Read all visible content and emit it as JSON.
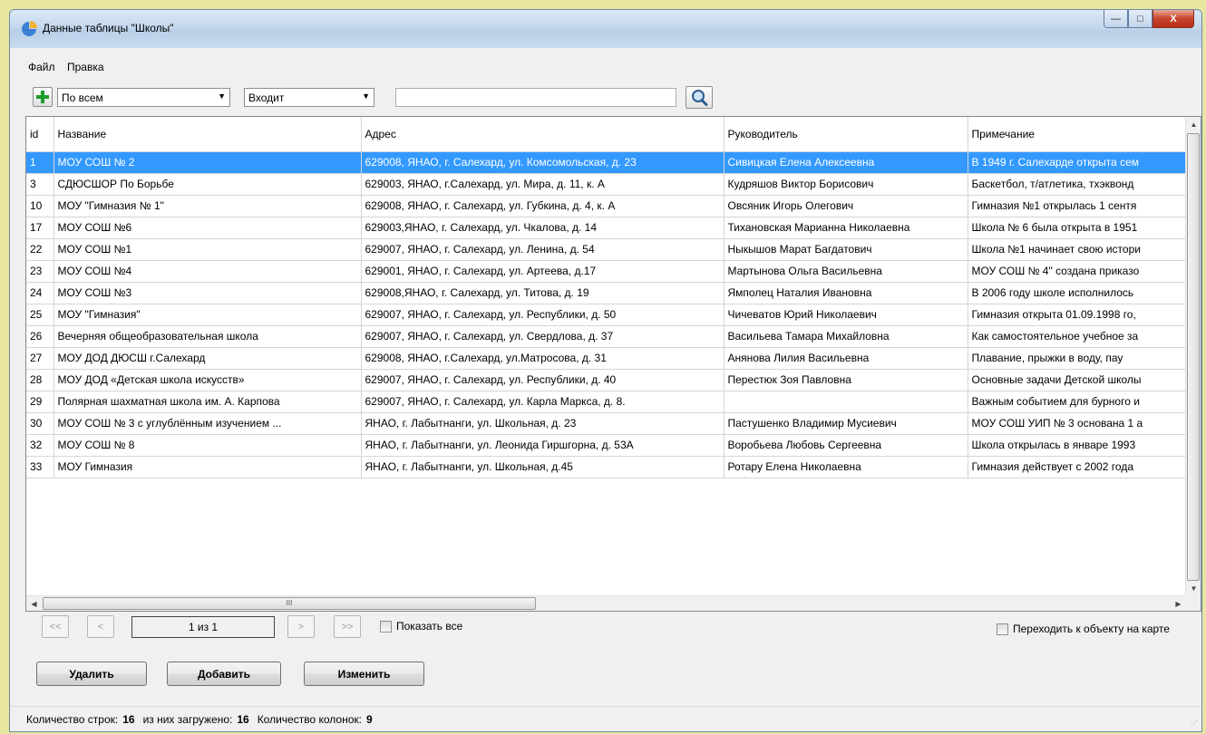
{
  "window": {
    "title": "Данные таблицы \"Школы\"",
    "controls": {
      "minimize": "—",
      "maximize": "□",
      "close": "X"
    }
  },
  "menu": [
    "Файл",
    "Правка"
  ],
  "toolbar": {
    "field_combo": "По всем",
    "condition_combo": "Входит",
    "search_value": ""
  },
  "grid": {
    "columns": [
      "id",
      "Название",
      "Адрес",
      "Руководитель",
      "Примечание"
    ],
    "rows": [
      [
        "1",
        "МОУ СОШ № 2",
        "629008, ЯНАО, г. Салехард, ул. Комсомольская, д. 23",
        "Сивицкая Елена Алексеевна",
        "В 1949 г. Салехарде открыта сем"
      ],
      [
        "3",
        "СДЮСШОР По Борьбе",
        "629003, ЯНАО,  г.Салехард, ул. Мира,  д. 11, к. А",
        "Кудряшов Виктор Борисович",
        "Баскетбол, т/атлетика, тхэквонд"
      ],
      [
        "10",
        "МОУ \"Гимназия № 1\"",
        "629008, ЯНАО, г. Салехард, ул. Губкина, д. 4, к. А",
        "Овсяник Игорь Олегович",
        "Гимназия №1 открылась 1 сентя"
      ],
      [
        "17",
        "МОУ СОШ №6",
        "629003,ЯНАО, г. Салехард, ул. Чкалова, д. 14",
        "Тихановская Марианна Николаевна",
        "Школа № 6 была открыта в 1951"
      ],
      [
        "22",
        "МОУ СОШ №1",
        "629007, ЯНАО, г. Салехард, ул. Ленина, д. 54",
        "Ныкышов Марат Багдатович",
        "Школа №1 начинает свою истори"
      ],
      [
        "23",
        "МОУ СОШ №4",
        "629001, ЯНАО, г. Салехард, ул. Артеева, д.17",
        "Мартынова Ольга Васильевна",
        "МОУ СОШ № 4\" создана приказо"
      ],
      [
        "24",
        "МОУ СОШ №3",
        "629008,ЯНАО, г. Салехард, ул. Титова, д. 19",
        "Ямполец Наталия Ивановна",
        "В 2006 году школе исполнилось"
      ],
      [
        "25",
        "МОУ \"Гимназия\"",
        "629007, ЯНАО, г. Салехард, ул. Республики, д. 50",
        "Чичеватов Юрий Николаевич",
        "Гимназия открыта 01.09.1998 го,"
      ],
      [
        "26",
        "Вечерняя общеобразовательная школа",
        "629007, ЯНАО, г. Салехард, ул. Свердлова, д. 37",
        "Васильева Тамара Михайловна",
        "Как самостоятельное учебное за"
      ],
      [
        "27",
        "МОУ ДОД ДЮСШ г.Салехард",
        "629008, ЯНАО, г.Салехард, ул.Матросова, д. 31",
        "Анянова Лилия Васильевна",
        "Плавание, прыжки в воду,     пау"
      ],
      [
        "28",
        "МОУ ДОД «Детская школа искусств»",
        "629007, ЯНАО, г. Салехард, ул. Республики, д. 40",
        "Перестюк Зоя Павловна",
        "Основные задачи Детской школы"
      ],
      [
        "29",
        "Полярная шахматная  школа им. А. Карпова",
        "629007, ЯНАО, г. Салехард, ул. Карла Маркса, д. 8.",
        "",
        "Важным событием для бурного и"
      ],
      [
        "30",
        "МОУ  СОШ  № 3 с углублённым изучением ...",
        "ЯНАО, г. Лабытнанги, ул. Школьная, д. 23",
        "Пастушенко Владимир Мусиевич",
        "МОУ СОШ УИП № 3 основана 1 а"
      ],
      [
        "32",
        "МОУ  СОШ  № 8",
        "ЯНАО, г. Лабытнанги, ул. Леонида Гиршгорна, д. 53А",
        "Воробьева Любовь Сергеевна",
        "Школа открылась в январе 1993"
      ],
      [
        "33",
        "МОУ  Гимназия",
        "ЯНАО, г. Лабытнанги, ул. Школьная, д.45",
        "Ротару  Елена Николаевна",
        "Гимназия действует с 2002 года"
      ]
    ],
    "selected_row": 0,
    "scroll_thumb_label": "III"
  },
  "pager": {
    "first": "<<",
    "prev": "<",
    "page_text": "1 из 1",
    "next": ">",
    "last": ">>",
    "show_all_label": "Показать все",
    "goto_map_label": "Переходить к объекту на карте"
  },
  "actions": {
    "delete": "Удалить",
    "add": "Добавить",
    "edit": "Изменить"
  },
  "status": {
    "rows_label": "Количество строк:",
    "rows_value": "16",
    "loaded_label": "из них загружено:",
    "loaded_value": "16",
    "columns_label": "Количество колонок:",
    "columns_value": "9"
  },
  "colors": {
    "selection": "#3399ff",
    "window_bg": "#f0f0f0",
    "desktop": "#e6e6a0"
  }
}
